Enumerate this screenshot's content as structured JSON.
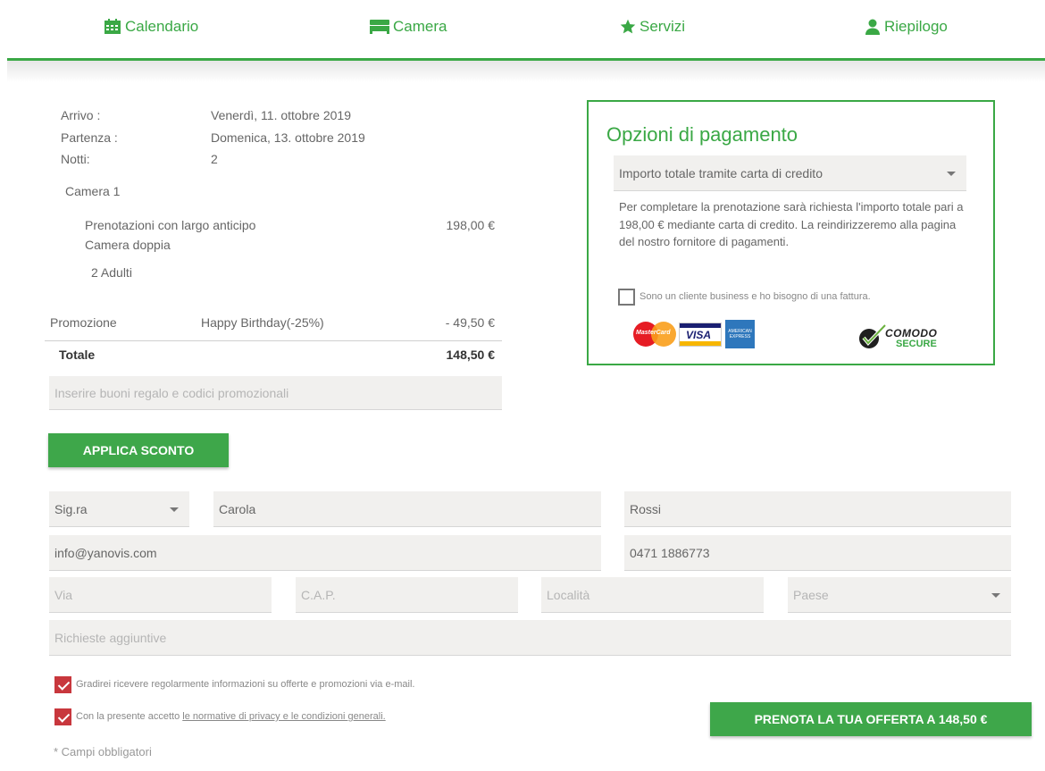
{
  "nav": {
    "calendar": "Calendario",
    "room": "Camera",
    "services": "Servizi",
    "summary": "Riepilogo"
  },
  "summary": {
    "arrival_label": "Arrivo :",
    "arrival_value": "Venerdì, 11. ottobre 2019",
    "departure_label": "Partenza :",
    "departure_value": "Domenica, 13. ottobre 2019",
    "nights_label": "Notti:",
    "nights_value": "2",
    "room_heading": "Camera 1",
    "rate_name": "Prenotazioni con largo anticipo",
    "rate_price": "198,00 €",
    "room_type": "Camera doppia",
    "guests": "2 Adulti",
    "promo_label": "Promozione",
    "promo_name": "Happy Birthday(-25%)",
    "promo_amount": "- 49,50 €",
    "total_label": "Totale",
    "total_value": "148,50 €",
    "voucher_placeholder": "Inserire buoni regalo e codici promozionali",
    "apply_button": "APPLICA SCONTO"
  },
  "payment": {
    "title": "Opzioni di pagamento",
    "method_selected": "Importo totale tramite carta di credito",
    "description": "Per completare la prenotazione sarà richiesta l'importo totale pari a 198,00 € mediante carta di credito. La reindirizzeremo alla pagina del nostro fornitore di pagamenti.",
    "business_label": "Sono un cliente business e ho bisogno di una fattura.",
    "logos": {
      "mastercard": "MasterCard",
      "visa": "VISA",
      "amex": "AMERICAN EXPRESS",
      "comodo": "COMODO",
      "comodo_sub": "SECURE"
    }
  },
  "form": {
    "salutation": "Sig.ra",
    "first_name": "Carola",
    "last_name": "Rossi",
    "email": "info@yanovis.com",
    "phone": "0471 1886773",
    "street_placeholder": "Via",
    "zip_placeholder": "C.A.P.",
    "city_placeholder": "Località",
    "country_placeholder": "Paese",
    "requests_placeholder": "Richieste aggiuntive",
    "newsletter_label": "Gradirei ricevere regolarmente informazioni su offerte e promozioni via e-mail.",
    "privacy_prefix": "Con la presente accetto",
    "privacy_link": "le normative di privacy e le condizioni generali.",
    "required_note": "* Campi obbligatori",
    "book_button": "PRENOTA LA TUA OFFERTA A 148,50 €"
  },
  "colors": {
    "accent_green": "#3aa845",
    "check_red": "#c8373d"
  }
}
